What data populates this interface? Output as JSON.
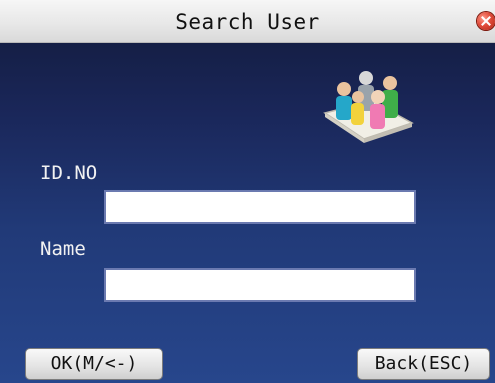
{
  "window": {
    "title": "Search User"
  },
  "form": {
    "id_label": "ID.NO",
    "id_value": "",
    "name_label": "Name",
    "name_value": ""
  },
  "buttons": {
    "ok_label": "OK(M/<-)",
    "back_label": "Back(ESC)"
  },
  "icons": {
    "close": "close-icon",
    "users": "users-group-icon"
  },
  "colors": {
    "background_top": "#121a3a",
    "background_bottom": "#27468c",
    "title_bar": "#e8e8e8",
    "close_button": "#e04b3a"
  }
}
